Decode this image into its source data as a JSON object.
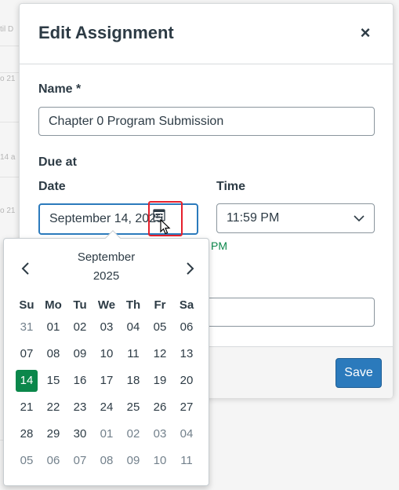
{
  "modal": {
    "title": "Edit Assignment",
    "close_label": "×"
  },
  "form": {
    "name_label": "Name *",
    "name_value": "Chapter 0 Program Submission",
    "due_label": "Due at",
    "date_label": "Date",
    "date_value": "September 14, 2025",
    "time_label": "Time",
    "time_value": "11:59 PM",
    "partial_note": "PM"
  },
  "footer": {
    "save_label": "Save"
  },
  "calendar": {
    "month": "September",
    "year": "2025",
    "weekdays": [
      "Su",
      "Mo",
      "Tu",
      "We",
      "Th",
      "Fr",
      "Sa"
    ],
    "selected": "14",
    "weeks": [
      [
        {
          "d": "31",
          "other": true
        },
        {
          "d": "01"
        },
        {
          "d": "02"
        },
        {
          "d": "03"
        },
        {
          "d": "04"
        },
        {
          "d": "05"
        },
        {
          "d": "06"
        }
      ],
      [
        {
          "d": "07"
        },
        {
          "d": "08"
        },
        {
          "d": "09"
        },
        {
          "d": "10"
        },
        {
          "d": "11"
        },
        {
          "d": "12"
        },
        {
          "d": "13"
        }
      ],
      [
        {
          "d": "14",
          "selected": true
        },
        {
          "d": "15"
        },
        {
          "d": "16"
        },
        {
          "d": "17"
        },
        {
          "d": "18"
        },
        {
          "d": "19"
        },
        {
          "d": "20"
        }
      ],
      [
        {
          "d": "21"
        },
        {
          "d": "22"
        },
        {
          "d": "23"
        },
        {
          "d": "24"
        },
        {
          "d": "25"
        },
        {
          "d": "26"
        },
        {
          "d": "27"
        }
      ],
      [
        {
          "d": "28"
        },
        {
          "d": "29"
        },
        {
          "d": "30"
        },
        {
          "d": "01",
          "other": true
        },
        {
          "d": "02",
          "other": true
        },
        {
          "d": "03",
          "other": true
        },
        {
          "d": "04",
          "other": true
        }
      ],
      [
        {
          "d": "05",
          "other": true
        },
        {
          "d": "06",
          "other": true
        },
        {
          "d": "07",
          "other": true
        },
        {
          "d": "08",
          "other": true
        },
        {
          "d": "09",
          "other": true
        },
        {
          "d": "10",
          "other": true
        },
        {
          "d": "11",
          "other": true
        }
      ]
    ]
  },
  "background": {
    "snippets": [
      "til D",
      "o 21",
      "14 a",
      "o 21"
    ]
  },
  "colors": {
    "primary": "#2b7abc",
    "success": "#0b874b",
    "highlight": "#e5202c"
  }
}
